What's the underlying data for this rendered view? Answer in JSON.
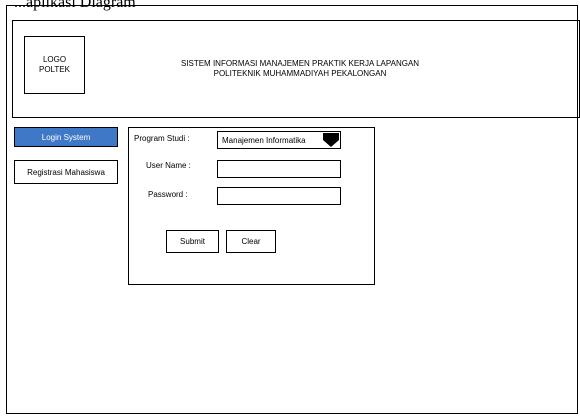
{
  "top_label": "...aplikasi Diagram",
  "header": {
    "logo_line1": "LOGO",
    "logo_line2": "POLTEK",
    "title_line1": "SISTEM INFORMASI MANAJEMEN PRAKTIK KERJA LAPANGAN",
    "title_line2": "POLITEKNIK MUHAMMADIYAH PEKALONGAN"
  },
  "sidebar": {
    "items": [
      {
        "label": "Login System",
        "active": true,
        "color": "#3e78c6"
      },
      {
        "label": "Registrasi Mahasiswa",
        "active": false
      }
    ]
  },
  "form": {
    "program_label": "Program Studi :",
    "program_value": "Manajemen Informatika",
    "username_label": "User Name :",
    "username_value": "",
    "password_label": "Password :",
    "password_value": "",
    "submit_label": "Submit",
    "clear_label": "Clear"
  }
}
